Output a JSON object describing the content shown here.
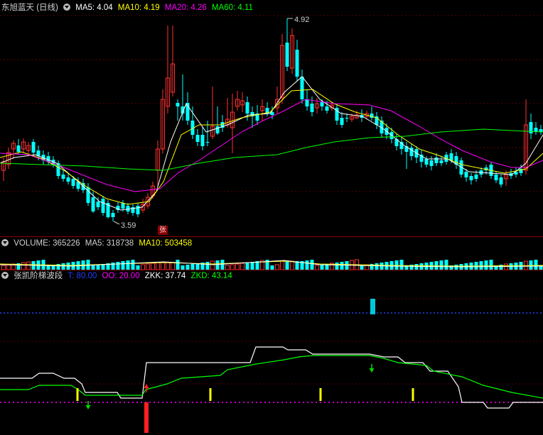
{
  "main": {
    "title": "东旭蓝天 (日线)",
    "ma5_label": "MA5: 4.04",
    "ma10_label": "MA10: 4.19",
    "ma20_label": "MA20: 4.26",
    "ma60_label": "MA60: 4.11",
    "high_label": "4.92",
    "low_label": "3.59",
    "marker_label": "张",
    "colors": {
      "ma5": "#ffffff",
      "ma10": "#ffff00",
      "ma20": "#ff00ff",
      "ma60": "#00ff00",
      "up": "#ff3030",
      "down": "#00ffff"
    }
  },
  "volume": {
    "vol_label": "VOLUME: 365226",
    "ma5_label": "MA5: 318738",
    "ma10_label": "MA10: 503458"
  },
  "indicator": {
    "name": "张凯阶梯波段",
    "t_label": "T: 80.00",
    "oo_label": "OO: 20.00",
    "zkk_label": "ZKK: 37.74",
    "zkd_label": "ZKD: 43.14"
  }
}
